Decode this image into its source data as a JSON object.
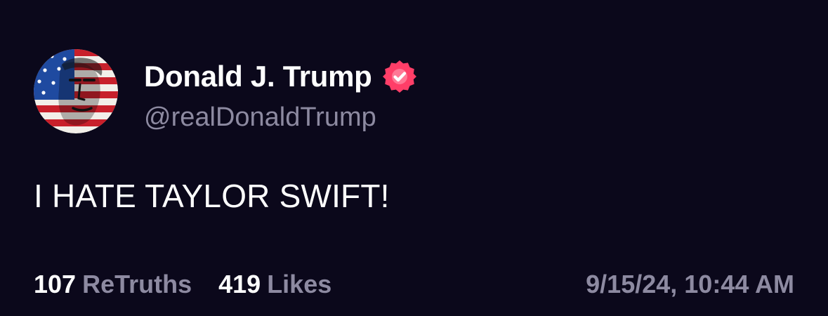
{
  "post": {
    "author": {
      "display_name": "Donald J. Trump",
      "handle": "@realDonaldTrump",
      "verified": true,
      "verified_icon": "verified-badge-icon",
      "avatar_icon": "profile-avatar"
    },
    "text": "I HATE TAYLOR SWIFT!",
    "stats": {
      "retruths_count": "107",
      "retruths_label": "ReTruths",
      "likes_count": "419",
      "likes_label": "Likes"
    },
    "timestamp": "9/15/24, 10:44 AM"
  },
  "colors": {
    "background": "#0b081b",
    "primary_text": "#ffffff",
    "secondary_text": "#8d8aa1",
    "verified_badge": "#ff3e68"
  }
}
